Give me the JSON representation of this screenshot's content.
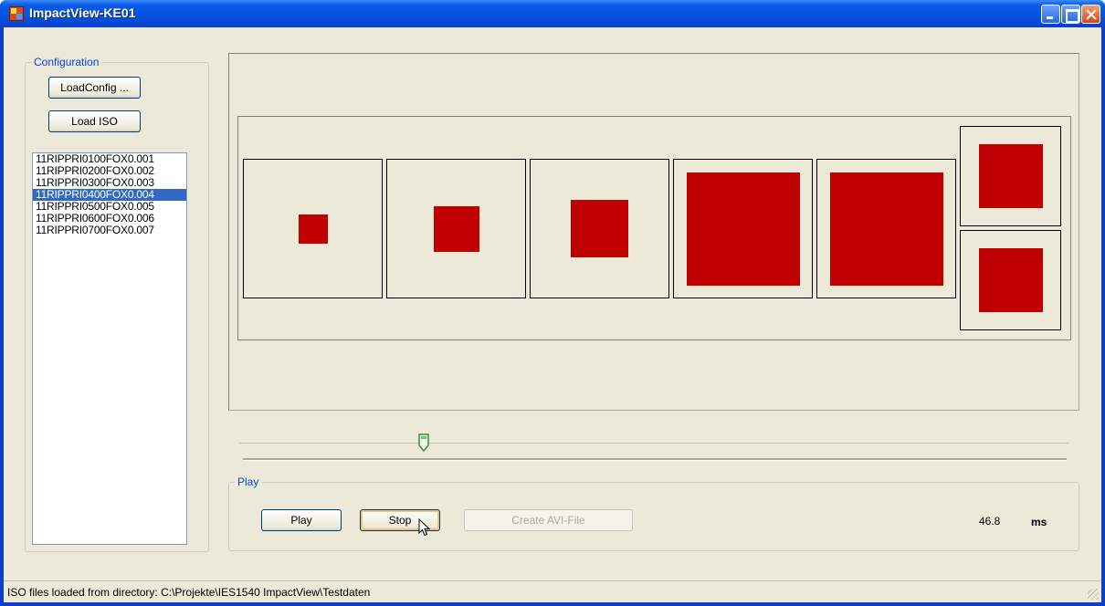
{
  "window": {
    "title": "ImpactView-KE01"
  },
  "configuration": {
    "group_label": "Configuration",
    "load_config_label": "LoadConfig ...",
    "load_iso_label": "Load ISO",
    "files": [
      "11RIPPRI0100FOX0.001",
      "11RIPPRI0200FOX0.002",
      "11RIPPRI0300FOX0.003",
      "11RIPPRI0400FOX0.004",
      "11RIPPRI0500FOX0.005",
      "11RIPPRI0600FOX0.006",
      "11RIPPRI0700FOX0.007"
    ],
    "selected_index": 3
  },
  "viewer": {
    "square_color": "#c00000",
    "square_fill_fractions": [
      0.21,
      0.33,
      0.42,
      0.82,
      0.82,
      0.65,
      0.65
    ]
  },
  "timeline": {
    "position_fraction": 0.22
  },
  "play": {
    "group_label": "Play",
    "play_label": "Play",
    "stop_label": "Stop",
    "avi_label": "Create AVI-File",
    "time_value": "46.8",
    "time_unit": "ms"
  },
  "status": {
    "text": "ISO files loaded from directory: C:\\Projekte\\IES1540 ImpactView\\Testdaten"
  },
  "colors": {
    "selection": "#316ac5",
    "group_title": "#0046d5",
    "titlebar": "#0453e0"
  }
}
